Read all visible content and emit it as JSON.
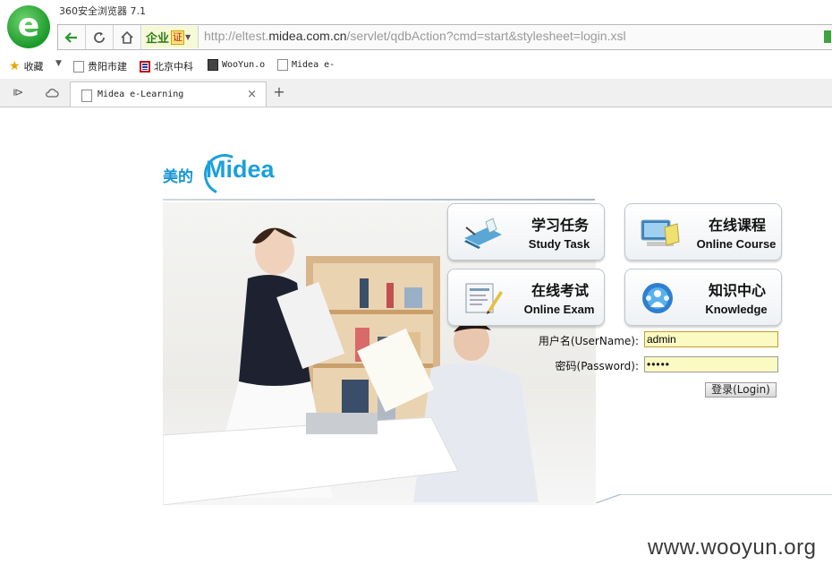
{
  "browser": {
    "app_title": "360安全浏览器 7.1",
    "enterprise_label": "企业",
    "cert_label": "证",
    "url_prefix": "http://eltest.",
    "url_host": "midea.com.cn",
    "url_path": "/servlet/qdbAction?cmd=start&stylesheet=login.xsl"
  },
  "bookmarks": {
    "favorites_label": "收藏",
    "items": [
      {
        "label": "贵阳市建"
      },
      {
        "label": "北京中科"
      },
      {
        "label": "WooYun.o"
      },
      {
        "label": "Midea e-"
      }
    ]
  },
  "tab": {
    "title": "Midea e-Learning",
    "close": "×",
    "new_tab": "+"
  },
  "page": {
    "brand_cn": "美的",
    "brand_en": "Midea",
    "tiles": [
      {
        "cn": "学习任务",
        "en": "Study Task",
        "icon": "study-task-icon"
      },
      {
        "cn": "在线课程",
        "en": "Online Course",
        "icon": "online-course-icon"
      },
      {
        "cn": "在线考试",
        "en": "Online Exam",
        "icon": "online-exam-icon"
      },
      {
        "cn": "知识中心",
        "en": "Knowledge",
        "icon": "knowledge-icon"
      }
    ],
    "login": {
      "username_label": "用户名(UserName):",
      "username_value": "admin",
      "password_label": "密码(Password):",
      "password_value": "•••••",
      "submit_label": "登录(Login)"
    }
  },
  "watermark": "www.wooyun.org",
  "colors": {
    "brand_blue": "#1aa0dc",
    "input_bg": "#fafac2"
  }
}
